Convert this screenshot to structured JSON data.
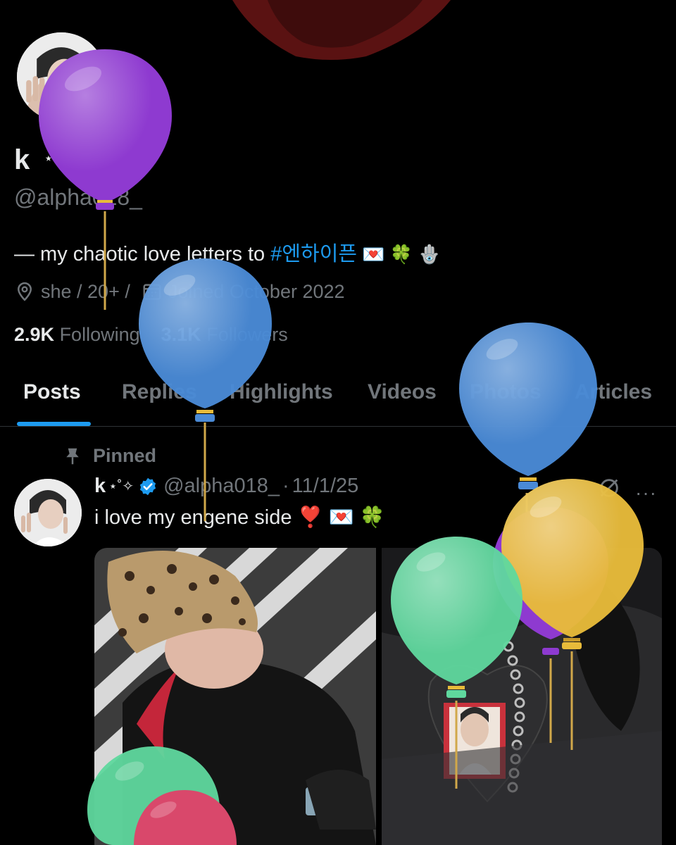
{
  "profile": {
    "display_name": "k",
    "name_decoration": "⋆˚✧",
    "handle": "@alpha018_",
    "bio_prefix": "— my chaotic love letters to ",
    "bio_hashtag": "#엔하이픈",
    "bio_emojis": " 💌 🍀 🪬",
    "pronouns": "she / 20+ /",
    "joined": "Joined October 2022",
    "following_count": "2.9K",
    "following_label": "Following",
    "followers_count": "3.1K",
    "followers_label": "Followers"
  },
  "tabs": [
    {
      "label": "Posts",
      "active": true
    },
    {
      "label": "Replies",
      "active": false
    },
    {
      "label": "Highlights",
      "active": false
    },
    {
      "label": "Videos",
      "active": false
    },
    {
      "label": "Photos",
      "active": false
    },
    {
      "label": "Articles",
      "active": false
    }
  ],
  "pinned_post": {
    "pinned_label": "Pinned",
    "author_name": "k",
    "author_decoration": "⋆˚✧",
    "author_handle": "@alpha018_",
    "separator": "·",
    "date": "11/1/25",
    "text": "i love my engene side ❣️ 💌 🍀",
    "more": "···"
  },
  "colors": {
    "background": "#000000",
    "accent": "#1d9bf0",
    "muted": "#71767b",
    "text": "#e7e9ea",
    "balloon_purple": "#8e3ad0",
    "balloon_blue": "#4a8ad6",
    "balloon_green": "#5fd89e",
    "balloon_yellow": "#e8bb3a",
    "balloon_pink": "#d9486b"
  },
  "icons": [
    "location-icon",
    "calendar-icon",
    "verified-badge-icon",
    "pin-icon",
    "grok-icon",
    "more-icon"
  ]
}
